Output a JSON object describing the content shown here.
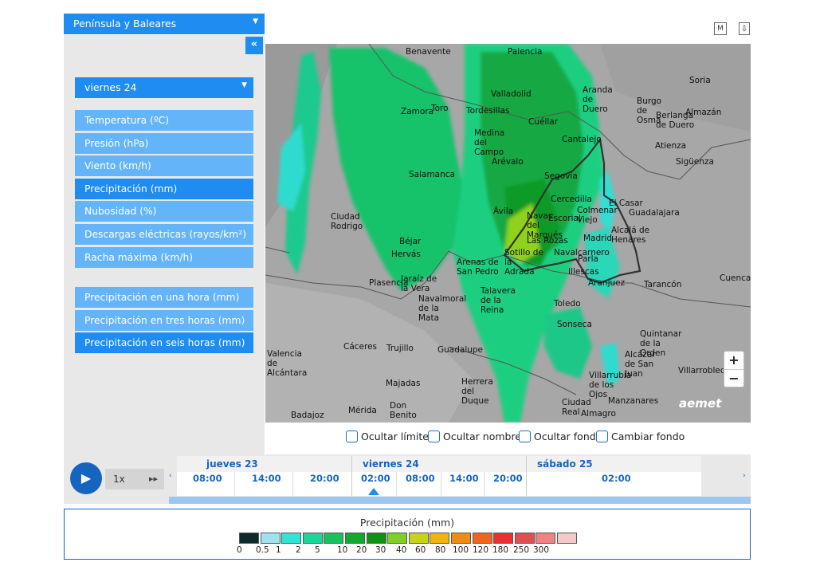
{
  "region": {
    "label": "Península y Baleares"
  },
  "collapse": {
    "label": "«"
  },
  "day_select": {
    "label": "viernes 24"
  },
  "menu_main": [
    {
      "label": "Temperatura (ºC)",
      "active": false
    },
    {
      "label": "Presión (hPa)",
      "active": false
    },
    {
      "label": "Viento (km/h)",
      "active": false
    },
    {
      "label": "Precipitación (mm)",
      "active": true
    },
    {
      "label": "Nubosidad (%)",
      "active": false
    },
    {
      "label": "Descargas eléctricas (rayos/km²)",
      "active": false
    },
    {
      "label": "Racha máxima (km/h)",
      "active": false
    }
  ],
  "menu_accum": [
    {
      "label": "Precipitación en una hora (mm)",
      "active": false
    },
    {
      "label": "Precipitación en tres horas (mm)",
      "active": false
    },
    {
      "label": "Precipitación en seis horas (mm)",
      "active": true
    }
  ],
  "top_buttons": {
    "m": "M",
    "download": "⇩"
  },
  "map": {
    "logo": "aemet",
    "zoom_in": "+",
    "zoom_out": "−",
    "cities": [
      "Benavente",
      "Palencia",
      "Soria",
      "Valladolid",
      "Aranda de Duero",
      "Zamora",
      "Toro",
      "Tordesillas",
      "Burgo de Osma",
      "Berlanga de Duero",
      "Almazán",
      "Cuéllar",
      "Medina del Campo",
      "Cantalejo",
      "Atienza",
      "Arévalo",
      "Sigüenza",
      "Salamanca",
      "Segovia",
      "Cercedilla",
      "El Casar",
      "Guadalajara",
      "Colmenar Viejo",
      "Ávila",
      "Navas del Marqués",
      "Escorial",
      "Ciudad Rodrigo",
      "Madrid",
      "Alcalá de Henares",
      "Béjar",
      "Las Rozas",
      "Hervás",
      "Sotillo de la Adrada",
      "Navalcarnero",
      "Parla",
      "Arenas de San Pedro",
      "Illescas",
      "Aranjuez",
      "Tarancón",
      "Cuenca",
      "Plasencia",
      "Jaraíz de la Vera",
      "Navalmoral de la Mata",
      "Talavera de la Reina",
      "Toledo",
      "Sonseca",
      "Quintanar de la Orden",
      "Valencia de Alcántara",
      "Cáceres",
      "Trujillo",
      "Guadalupe",
      "Alcázar de San Juan",
      "Villarrobledo",
      "Villarrubia de los Ojos",
      "Manzanares",
      "Herrera del Duque",
      "Majadas",
      "Ciudad Real",
      "Almagro",
      "Mérida",
      "Don Benito",
      "Badajoz"
    ]
  },
  "toggles": [
    {
      "label": "Ocultar límites"
    },
    {
      "label": "Ocultar nombres"
    },
    {
      "label": "Ocultar fondo"
    },
    {
      "label": "Cambiar fondo"
    }
  ],
  "timeline": {
    "play_icon": "▶",
    "speed": "1x",
    "ff_icon": "▸▸",
    "prev": "‹",
    "next": "›",
    "days": [
      "jueves 23",
      "viernes 24",
      "sábado 25"
    ],
    "hours": [
      "08:00",
      "14:00",
      "20:00",
      "02:00",
      "08:00",
      "14:00",
      "20:00",
      "02:00"
    ],
    "selected_hour": "02:00"
  },
  "legend": {
    "title": "Precipitación (mm)",
    "labels": [
      "0",
      "0.5",
      "1",
      "2",
      "5",
      "10",
      "20",
      "30",
      "40",
      "60",
      "80",
      "100",
      "120",
      "180",
      "250",
      "300"
    ],
    "colors": [
      "#0b2a2a",
      "#9fe1ee",
      "#2ee6d6",
      "#1ed49a",
      "#18c25a",
      "#10aa2c",
      "#0f9214",
      "#7ed022",
      "#c8d21a",
      "#f0b414",
      "#f08c14",
      "#f0641e",
      "#e83232",
      "#e05050",
      "#f08282",
      "#f6c8c8"
    ]
  }
}
